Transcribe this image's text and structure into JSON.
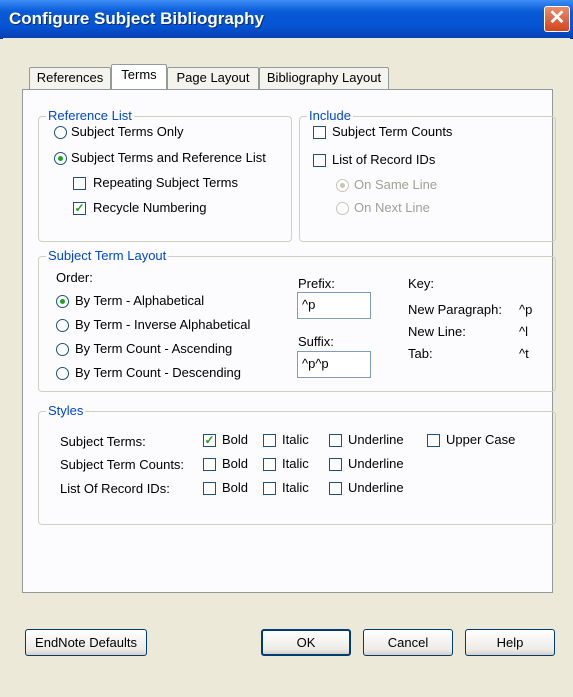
{
  "window": {
    "title": "Configure Subject Bibliography",
    "close_glyph": "✕"
  },
  "tabs": [
    {
      "label": "References"
    },
    {
      "label": "Terms",
      "active": true
    },
    {
      "label": "Page Layout"
    },
    {
      "label": "Bibliography Layout"
    }
  ],
  "reference_list": {
    "legend": "Reference List",
    "subject_terms_only": "Subject Terms Only",
    "subject_terms_and_reference_list": "Subject Terms and Reference List",
    "repeating_subject_terms": "Repeating Subject Terms",
    "recycle_numbering": "Recycle Numbering",
    "selected": "subject_terms_and_reference_list",
    "repeating_checked": false,
    "recycle_checked": true
  },
  "include": {
    "legend": "Include",
    "subject_term_counts": "Subject Term Counts",
    "list_of_record_ids": "List of Record IDs",
    "on_same_line": "On Same Line",
    "on_next_line": "On Next Line"
  },
  "layout": {
    "legend": "Subject Term Layout",
    "order_label": "Order:",
    "orders": [
      "By Term - Alphabetical",
      "By Term - Inverse Alphabetical",
      "By Term Count - Ascending",
      "By Term Count - Descending"
    ],
    "selected_order": 0,
    "prefix_label": "Prefix:",
    "prefix_value": "^p",
    "suffix_label": "Suffix:",
    "suffix_value": "^p^p",
    "key_label": "Key:",
    "keys": [
      {
        "name": "New Paragraph:",
        "code": "^p"
      },
      {
        "name": "New Line:",
        "code": "^l"
      },
      {
        "name": "Tab:",
        "code": "^t"
      }
    ]
  },
  "styles": {
    "legend": "Styles",
    "bold": "Bold",
    "italic": "Italic",
    "underline": "Underline",
    "upper_case": "Upper Case",
    "rows": [
      {
        "label": "Subject Terms:",
        "bold": true
      },
      {
        "label": "Subject Term Counts:",
        "bold": false
      },
      {
        "label": "List Of Record IDs:",
        "bold": false
      }
    ]
  },
  "buttons": {
    "endnote_defaults": "EndNote Defaults",
    "ok": "OK",
    "cancel": "Cancel",
    "help": "Help"
  },
  "check_glyph": "✓"
}
